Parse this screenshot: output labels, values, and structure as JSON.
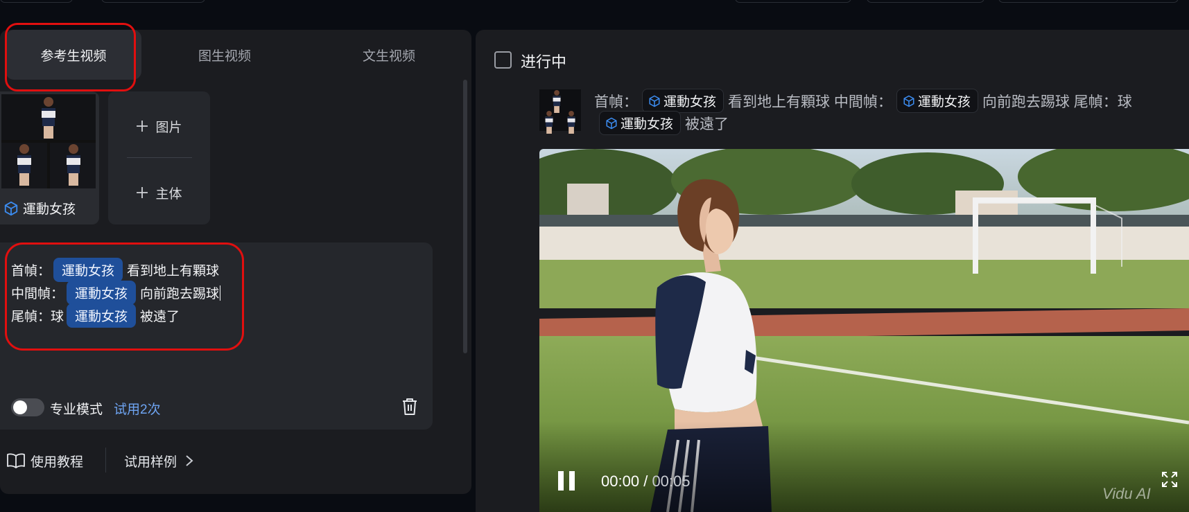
{
  "tabs": [
    {
      "label": "参考生视频",
      "active": true
    },
    {
      "label": "图生视频",
      "active": false
    },
    {
      "label": "文生视频",
      "active": false
    }
  ],
  "subject_card": {
    "label": "運動女孩",
    "icon": "cube-icon"
  },
  "add_card": {
    "image_label": "图片",
    "subject_label": "主体"
  },
  "prompt": {
    "lines": [
      {
        "prefix": "首幀：",
        "chip": "運動女孩",
        "suffix": "看到地上有顆球"
      },
      {
        "prefix": "中間幀：",
        "chip": "運動女孩",
        "suffix": "向前跑去踢球"
      },
      {
        "prefix": "尾幀：球",
        "chip": "運動女孩",
        "suffix": "被遠了"
      }
    ],
    "pro_mode_label": "专业模式",
    "trial_label": "试用2次",
    "pro_mode_on": false
  },
  "bottom": {
    "tutorial_label": "使用教程",
    "examples_label": "试用样例"
  },
  "task": {
    "status_label": "进行中",
    "desc_line1": [
      "首幀：",
      "運動女孩",
      "看到地上有顆球 中間幀：",
      "運動女孩",
      "向前跑去踢球 尾幀：球"
    ],
    "desc_line2": [
      "運動女孩",
      "被遠了"
    ]
  },
  "player": {
    "current": "00:00",
    "separator": "/",
    "total": "00:05",
    "watermark": "Vidu AI"
  },
  "colors": {
    "accent_blue": "#1f4f9a",
    "link_blue": "#6ea4f2",
    "highlight_red": "#e10f0f"
  }
}
